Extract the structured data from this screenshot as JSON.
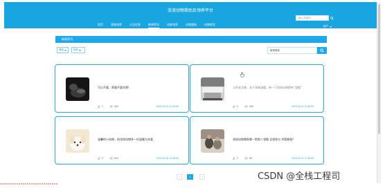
{
  "header": {
    "site_title": "流浪动物救助及领养平台",
    "nav": [
      {
        "label": "首页",
        "active": false
      },
      {
        "label": "宠物领养",
        "active": false
      },
      {
        "label": "公告信息",
        "active": false
      },
      {
        "label": "新闻资讯",
        "active": true
      },
      {
        "label": "动物领养",
        "active": false
      },
      {
        "label": "动物救助",
        "active": false
      },
      {
        "label": "动物转发",
        "active": false
      }
    ],
    "search_placeholder": "输入关键词",
    "user_label": "用户",
    "icons": {
      "search": "search-icon",
      "dropdown": "chevron-down-icon"
    }
  },
  "section": {
    "title": "新闻资讯"
  },
  "filters": {
    "sort_label": "筛选",
    "order_label": "排序",
    "search_value": "新闻搜索"
  },
  "news": [
    {
      "title": "可以不要，养猫不爱伤害!",
      "likes": "1",
      "views": "602",
      "date": "2023-04-11 11:46:53",
      "title_muted": false
    },
    {
      "title": "当你关注着，关于宠物涵籍，每一只流浪动物都有\"温暖\"",
      "likes": "0",
      "views": "390",
      "date": "2023-04-11 11:46:53",
      "title_muted": true
    },
    {
      "title": "温馨的小动物，给流浪动物多一份温暖与关爱",
      "likes": "0",
      "views": "634",
      "date": "2023-04-11 11:46:54",
      "title_muted": false
    },
    {
      "title": "流浪动物救助哪一脸助人领跟 全程参与 你我救助!",
      "likes": "0",
      "views": "68",
      "date": "2023-04-11 11:46:54",
      "title_muted": false
    }
  ],
  "pagination": {
    "prev": "‹",
    "current": "1",
    "next": "›"
  },
  "watermark": "CSDN @全栈工程司",
  "colors": {
    "accent": "#1ea9e6",
    "card_border": "#29a8df"
  }
}
